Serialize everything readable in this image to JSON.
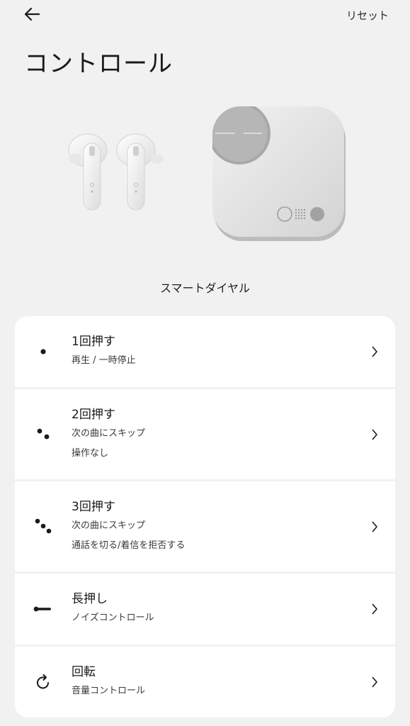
{
  "header": {
    "back_icon": "arrow-left-icon",
    "reset_label": "リセット"
  },
  "page": {
    "title": "コントロール"
  },
  "device": {
    "name": "スマートダイヤル"
  },
  "controls": [
    {
      "icon": "single-dot-icon",
      "title": "1回押す",
      "lines": [
        "再生 / 一時停止"
      ]
    },
    {
      "icon": "double-dot-icon",
      "title": "2回押す",
      "lines": [
        "次の曲にスキップ",
        "操作なし"
      ]
    },
    {
      "icon": "triple-dot-icon",
      "title": "3回押す",
      "lines": [
        "次の曲にスキップ",
        "通話を切る/着信を拒否する"
      ]
    },
    {
      "icon": "long-press-dash-icon",
      "title": "長押し",
      "lines": [
        "ノイズコントロール"
      ]
    },
    {
      "icon": "rotate-icon",
      "title": "回転",
      "lines": [
        "音量コントロール"
      ]
    }
  ],
  "colors": {
    "background": "#f1f1f1",
    "card": "#ffffff",
    "text": "#1a1a1a"
  }
}
